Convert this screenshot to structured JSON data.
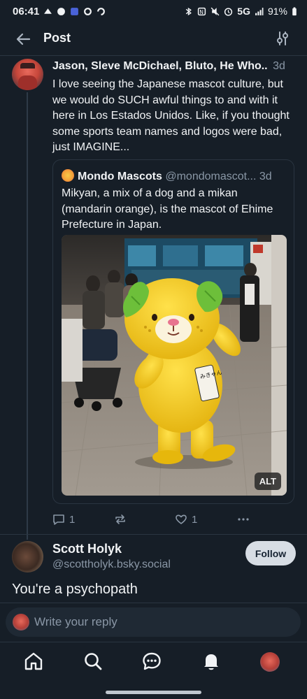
{
  "status_bar": {
    "time": "06:41",
    "network": "5G",
    "battery": "91%"
  },
  "header": {
    "title": "Post"
  },
  "post": {
    "author": "Jason, Sleve McDichael, Bluto, He Who..",
    "time": "3d",
    "text": "I love seeing the Japanese mascot culture, but we would do SUCH awful things to and with it here in Los Estados Unidos. Like, if you thought some sports team names and logos were bad, just IMAGINE...",
    "quote": {
      "name": "Mondo Mascots",
      "handle": "@mondomascot...",
      "time": "3d",
      "text": "Mikyan, a mix of a dog and a mikan (mandarin orange), is the mascot of Ehime Prefecture in Japan.",
      "image_alt_badge": "ALT",
      "sign_text": "みきゃん"
    },
    "actions": {
      "replies": "1",
      "likes": "1"
    }
  },
  "reply": {
    "name": "Scott Holyk",
    "handle": "@scottholyk.bsky.social",
    "follow_label": "Follow",
    "text": "You're a psychopath"
  },
  "composer": {
    "placeholder": "Write your reply"
  },
  "icons": {
    "back": "arrow-left-icon",
    "settings": "sliders-icon",
    "reply": "speech-bubble-icon",
    "repost": "repost-icon",
    "like": "heart-icon",
    "more": "ellipsis-icon",
    "nav_home": "home-icon",
    "nav_search": "search-icon",
    "nav_chat": "chat-icon",
    "nav_notifications": "bell-icon"
  },
  "colors": {
    "background": "#161e27",
    "text": "#f1f3f5",
    "muted": "#8a97a6",
    "border": "#2a3541",
    "mascot_yellow": "#f2cf22",
    "mascot_leaf": "#6dbf3a"
  }
}
